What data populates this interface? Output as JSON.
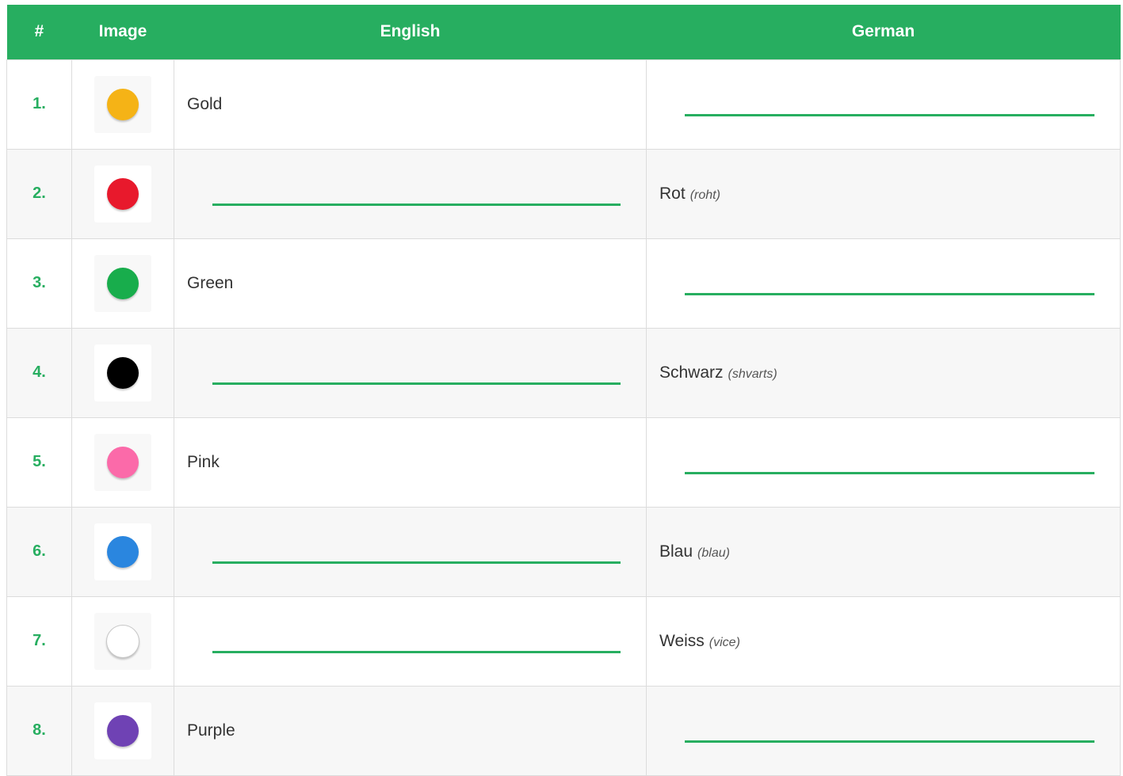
{
  "header": {
    "num": "#",
    "image": "Image",
    "english": "English",
    "german": "German"
  },
  "rows": [
    {
      "num": "1.",
      "color_name": "gold",
      "color": "#f5b316",
      "english": "Gold",
      "german": "",
      "pron": ""
    },
    {
      "num": "2.",
      "color_name": "red",
      "color": "#e8192c",
      "english": "",
      "german": "Rot",
      "pron": "(roht)"
    },
    {
      "num": "3.",
      "color_name": "green",
      "color": "#18ad4c",
      "english": "Green",
      "german": "",
      "pron": ""
    },
    {
      "num": "4.",
      "color_name": "black",
      "color": "#000000",
      "english": "",
      "german": "Schwarz",
      "pron": "(shvarts)"
    },
    {
      "num": "5.",
      "color_name": "pink",
      "color": "#fb6aa9",
      "english": "Pink",
      "german": "",
      "pron": ""
    },
    {
      "num": "6.",
      "color_name": "blue",
      "color": "#2a86df",
      "english": "",
      "german": "Blau",
      "pron": "(blau)"
    },
    {
      "num": "7.",
      "color_name": "white",
      "color": "#ffffff",
      "english": "",
      "german": "Weiss",
      "pron": "(vice)"
    },
    {
      "num": "8.",
      "color_name": "purple",
      "color": "#6f42b4",
      "english": "Purple",
      "german": "",
      "pron": ""
    }
  ]
}
